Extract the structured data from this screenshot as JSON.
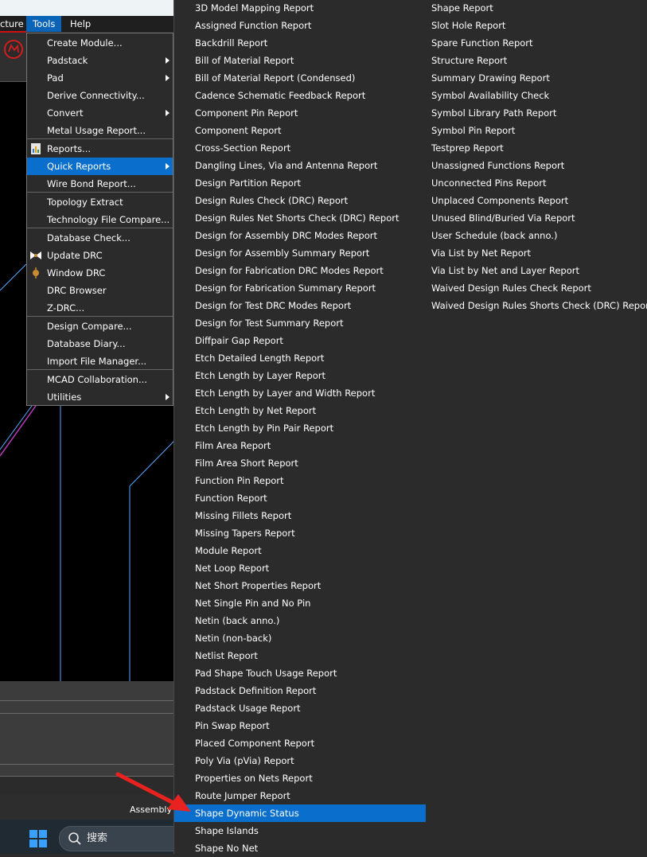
{
  "menubar": {
    "items": [
      {
        "id": "structure",
        "label": "cture"
      },
      {
        "id": "tools",
        "label": "Tools"
      },
      {
        "id": "help",
        "label": "Help"
      }
    ]
  },
  "tools_menu": {
    "items": [
      {
        "label": "Create Module...",
        "submenu": false
      },
      {
        "label": "Padstack",
        "submenu": true
      },
      {
        "label": "Pad",
        "submenu": true
      },
      {
        "label": "Derive Connectivity...",
        "submenu": false
      },
      {
        "label": "Convert",
        "submenu": true
      },
      {
        "label": "Metal Usage Report...",
        "submenu": false
      },
      {
        "label": "Reports...",
        "submenu": false,
        "icon": "report-icon"
      },
      {
        "label": "Quick Reports",
        "submenu": true,
        "highlighted": true
      },
      {
        "label": "Wire Bond Report...",
        "submenu": false
      },
      {
        "label": "Topology Extract",
        "submenu": false
      },
      {
        "label": "Technology File Compare...",
        "submenu": false
      },
      {
        "label": "Database Check...",
        "submenu": false
      },
      {
        "label": "Update DRC",
        "submenu": false,
        "icon": "update-drc-icon"
      },
      {
        "label": "Window DRC",
        "submenu": false,
        "icon": "window-drc-icon"
      },
      {
        "label": "DRC Browser",
        "submenu": false
      },
      {
        "label": "Z-DRC...",
        "submenu": false
      },
      {
        "label": "Design Compare...",
        "submenu": false
      },
      {
        "label": "Database Diary...",
        "submenu": false
      },
      {
        "label": "Import File Manager...",
        "submenu": false
      },
      {
        "label": "MCAD Collaboration...",
        "submenu": false
      },
      {
        "label": "Utilities",
        "submenu": true
      }
    ]
  },
  "quick_reports": {
    "column1": [
      "3D Model Mapping Report",
      "Assigned Function Report",
      "Backdrill Report",
      "Bill of Material Report",
      "Bill of Material Report (Condensed)",
      "Cadence Schematic Feedback Report",
      "Component Pin Report",
      "Component Report",
      "Cross-Section Report",
      "Dangling Lines, Via and Antenna Report",
      "Design Partition Report",
      "Design Rules Check (DRC) Report",
      "Design Rules Net Shorts Check (DRC) Report",
      "Design for Assembly DRC Modes Report",
      "Design for Assembly Summary Report",
      "Design for Fabrication DRC Modes Report",
      "Design for Fabrication Summary Report",
      "Design for Test DRC Modes Report",
      "Design for Test Summary Report",
      "Diffpair Gap Report",
      "Etch Detailed Length Report",
      "Etch Length by Layer Report",
      "Etch Length by Layer and Width Report",
      "Etch Length by Net Report",
      "Etch Length by Pin Pair Report",
      "Film Area Report",
      "Film Area Short Report",
      "Function Pin Report",
      "Function Report",
      "Missing Fillets Report",
      "Missing Tapers Report",
      "Module Report",
      "Net Loop Report",
      "Net Short Properties Report",
      "Net Single Pin and No Pin",
      "Netin (back anno.)",
      "Netin (non-back)",
      "Netlist Report",
      "Pad Shape Touch Usage Report",
      "Padstack Definition Report",
      "Padstack Usage Report",
      "Pin Swap Report",
      "Placed Component Report",
      "Poly Via (pVia) Report",
      "Properties on Nets Report",
      "Route Jumper Report",
      "Shape Dynamic Status",
      "Shape Islands",
      "Shape No Net"
    ],
    "column2": [
      "Shape Report",
      "Slot Hole Report",
      "Spare Function Report",
      "Structure Report",
      "Summary Drawing Report",
      "Symbol Availability Check",
      "Symbol Library Path Report",
      "Symbol Pin Report",
      "Testprep Report",
      "Unassigned Functions Report",
      "Unconnected Pins Report",
      "Unplaced Components Report",
      "Unused Blind/Buried Via Report",
      "User Schedule (back anno.)",
      "Via List by Net Report",
      "Via List by Net and Layer Report",
      "Waived Design Rules Check Report",
      "Waived Design Rules Shorts Check (DRC) Report"
    ],
    "highlighted": "Shape Dynamic Status"
  },
  "status_bar": {
    "text": "Assembly"
  },
  "taskbar": {
    "search_label": "搜索"
  },
  "colors": {
    "menu_bg": "#2b2b2b",
    "highlight": "#0a6fcc",
    "canvas": "#000000",
    "annotation_arrow": "#e8231f"
  }
}
